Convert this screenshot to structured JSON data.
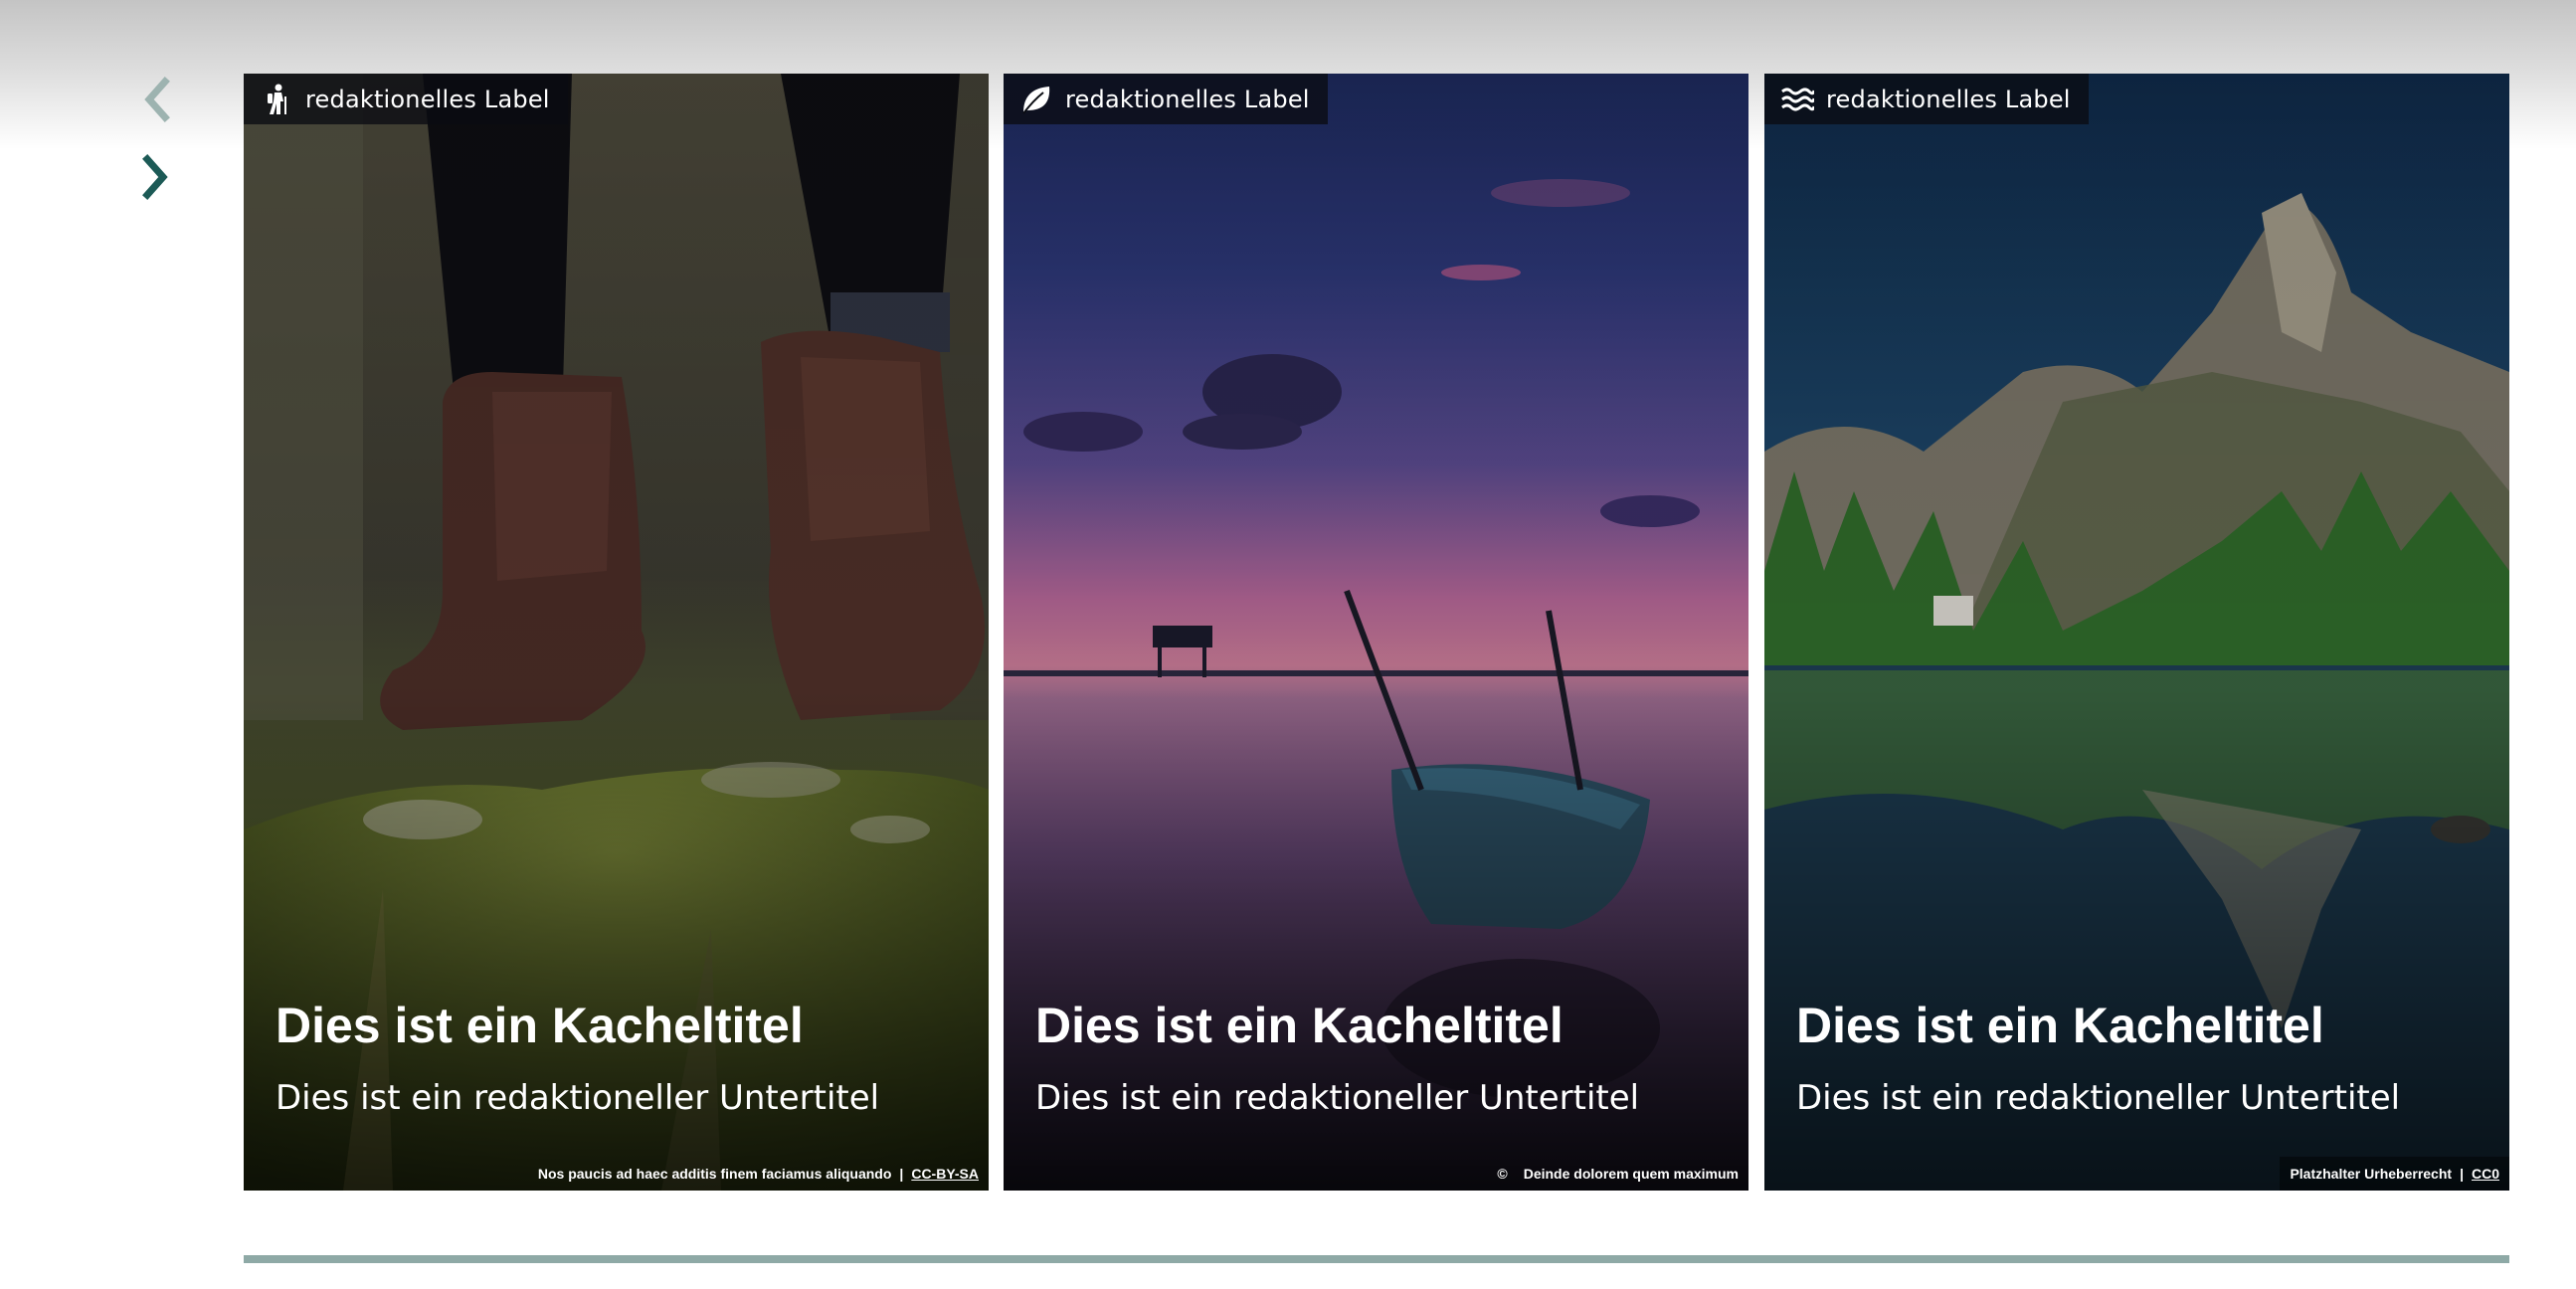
{
  "colors": {
    "nav_prev": "#9db3b0",
    "nav_next": "#1c5a56",
    "progress": "#8ea9a6",
    "chip_bg": "#0a0c12"
  },
  "nav": {
    "prev_icon": "chevron-left-icon",
    "next_icon": "chevron-right-icon"
  },
  "tiles": [
    {
      "label": "redaktionelles Label",
      "label_icon": "hiker-icon",
      "title": "Dies ist ein Kacheltitel",
      "subtitle": "Dies ist ein redaktioneller Untertitel",
      "credit_text": "Nos paucis ad haec additis finem faciamus aliquando",
      "credit_separator": "|",
      "credit_license": "CC-BY-SA"
    },
    {
      "label": "redaktionelles Label",
      "label_icon": "leaf-icon",
      "title": "Dies ist ein Kacheltitel",
      "subtitle": "Dies ist ein redaktioneller Untertitel",
      "credit_symbol": "©",
      "credit_text": "Deinde dolorem quem maximum"
    },
    {
      "label": "redaktionelles Label",
      "label_icon": "waves-icon",
      "title": "Dies ist ein Kacheltitel",
      "subtitle": "Dies ist ein redaktioneller Untertitel",
      "credit_text": "Platzhalter Urheberrecht",
      "credit_separator": "|",
      "credit_license": "CC0"
    }
  ]
}
